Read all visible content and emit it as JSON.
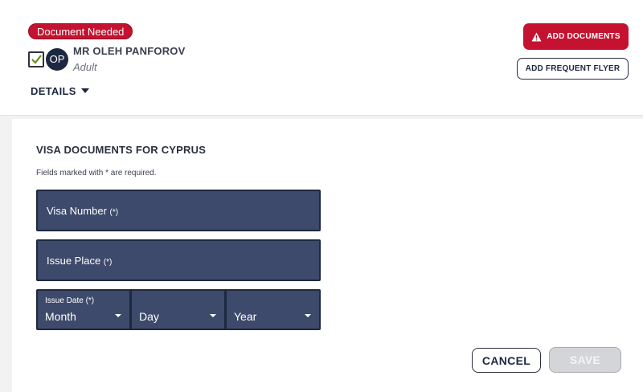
{
  "passenger": {
    "status_badge": "Document Needed",
    "initials": "OP",
    "name": "MR OLEH PANFOROV",
    "type": "Adult",
    "details_label": "DETAILS",
    "checked": true
  },
  "actions": {
    "add_documents": "ADD DOCUMENTS",
    "add_frequent_flyer": "ADD FREQUENT FLYER"
  },
  "visa_form": {
    "title": "VISA DOCUMENTS FOR CYPRUS",
    "required_note": "Fields marked with * are required.",
    "visa_number_label": "Visa Number",
    "issue_place_label": "Issue Place",
    "required_marker": "(*)",
    "issue_date_label": "Issue Date (*)",
    "month": "Month",
    "day": "Day",
    "year": "Year",
    "cancel_label": "CANCEL",
    "save_label": "SAVE"
  },
  "colors": {
    "brand_red": "#c41230",
    "navy": "#1c2740",
    "field_bg": "#3e4a6b"
  }
}
